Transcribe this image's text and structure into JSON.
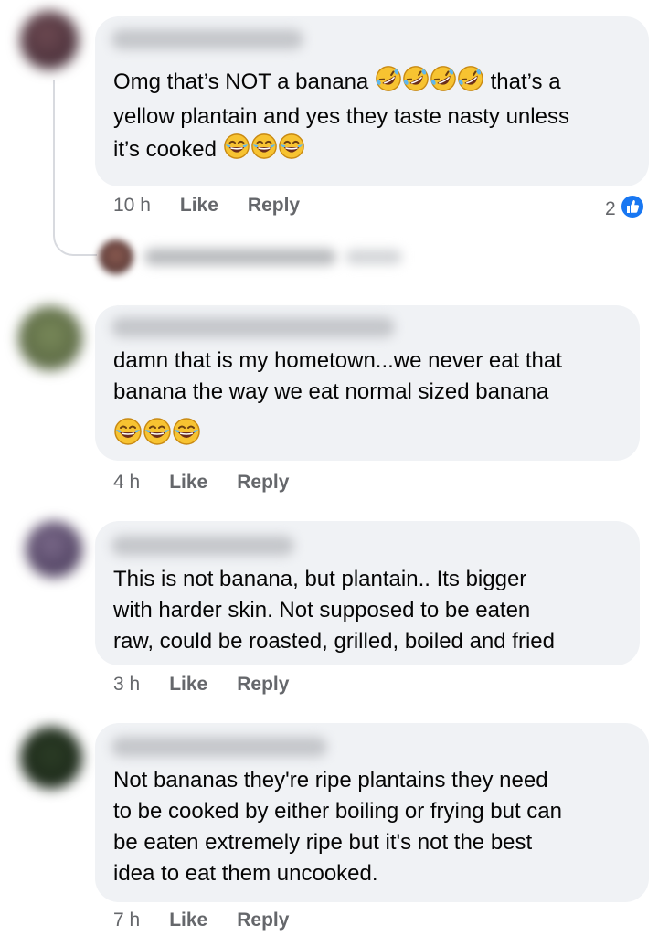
{
  "comments": [
    {
      "text": "Omg that’s NOT a banana ",
      "text_after_emoji": " that’s a\nyellow plantain and yes they taste nasty unless\nit’s cooked ",
      "time": "10 h",
      "like_label": "Like",
      "reply_label": "Reply",
      "reaction_count": "2",
      "reaction_icon": "thumbs-up-icon",
      "emoji_1": "rolling-on-floor-laughing-icon x4",
      "emoji_2": "tears-of-joy-icon x3"
    },
    {
      "text": "damn that is my hometown...we never eat that\nbanana the way we eat normal sized banana",
      "emoji": "tears-of-joy-icon x3",
      "time": "4 h",
      "like_label": "Like",
      "reply_label": "Reply"
    },
    {
      "text": "This is not banana, but plantain.. Its bigger\nwith harder skin. Not supposed to be eaten\nraw, could be roasted, grilled, boiled and fried",
      "time": "3 h",
      "like_label": "Like",
      "reply_label": "Reply"
    },
    {
      "text": "Not bananas they're ripe plantains they need\nto be cooked by either boiling or frying but can\nbe eaten extremely ripe but it's not the best\nidea to eat them uncooked.",
      "time": "7 h",
      "like_label": "Like",
      "reply_label": "Reply"
    }
  ],
  "colors": {
    "bubble": "#f0f2f5",
    "meta": "#65676b",
    "like_blue": "#1877f2"
  }
}
